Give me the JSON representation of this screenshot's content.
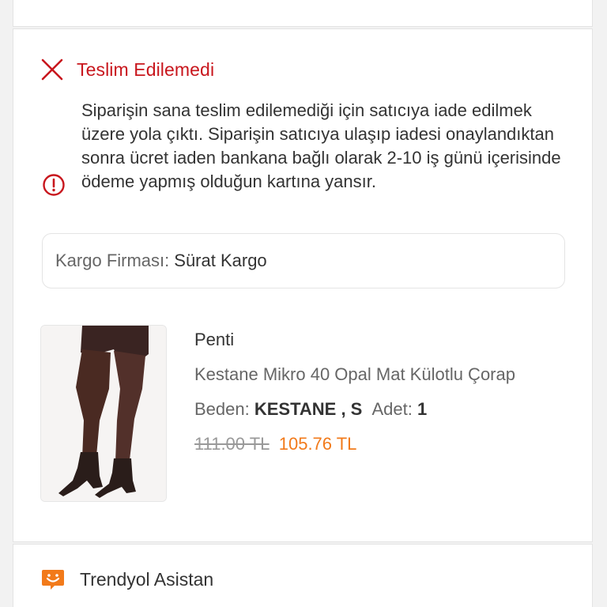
{
  "status": {
    "label": "Teslim Edilemedi",
    "color": "#c8161d",
    "icon": "close-icon"
  },
  "info": {
    "icon": "info-circle-icon",
    "message": "Siparişin sana teslim edilemediği için satıcıya iade edilmek üzere yola çıktı. Siparişin satıcıya ulaşıp iadesi onaylandıktan sonra ücret iaden bankana bağlı olarak 2-10 iş günü içerisinde ödeme yapmış olduğun kartına yansır."
  },
  "cargo": {
    "label": "Kargo Firması:",
    "value": "Sürat Kargo"
  },
  "product": {
    "brand": "Penti",
    "name": "Kestane Mikro 40 Opal Mat Külotlu Çorap",
    "size_label": "Beden:",
    "size_value": "KESTANE , S",
    "qty_label": "Adet:",
    "qty_value": "1",
    "old_price": "111.00 TL",
    "new_price": "105.76 TL",
    "price_color": "#f27a1a"
  },
  "assistant": {
    "label": "Trendyol Asistan",
    "icon": "assistant-chat-icon",
    "color": "#f27a1a"
  }
}
